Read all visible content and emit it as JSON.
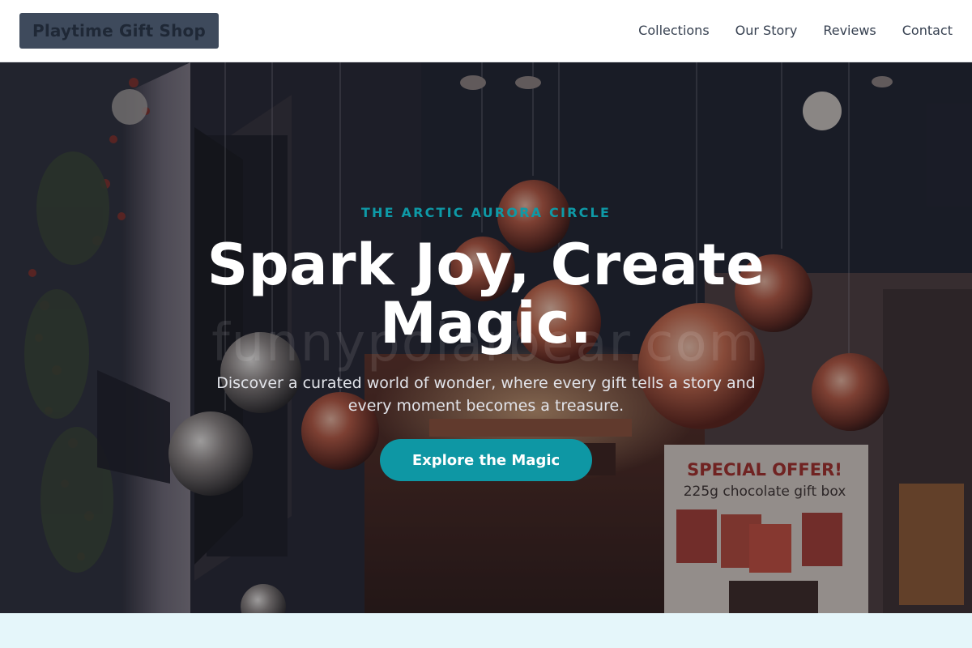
{
  "header": {
    "logo_text": "Playtime Gift Shop",
    "nav": [
      {
        "label": "Collections"
      },
      {
        "label": "Our Story"
      },
      {
        "label": "Reviews"
      },
      {
        "label": "Contact"
      }
    ]
  },
  "hero": {
    "eyebrow": "THE ARCTIC AURORA CIRCLE",
    "headline": "Spark Joy, Create Magic.",
    "subcopy": "Discover a curated world of wonder, where every gift tells a story and every moment becomes a treasure.",
    "cta_label": "Explore the Magic",
    "watermark": "funnypolarbear.com",
    "photo_sign": {
      "title": "SPECIAL OFFER!",
      "subtitle": "225g chocolate gift box"
    }
  },
  "colors": {
    "accent": "#0e97a4",
    "logo_bg": "#3e4a5c",
    "section_band": "#e5f6fa"
  }
}
